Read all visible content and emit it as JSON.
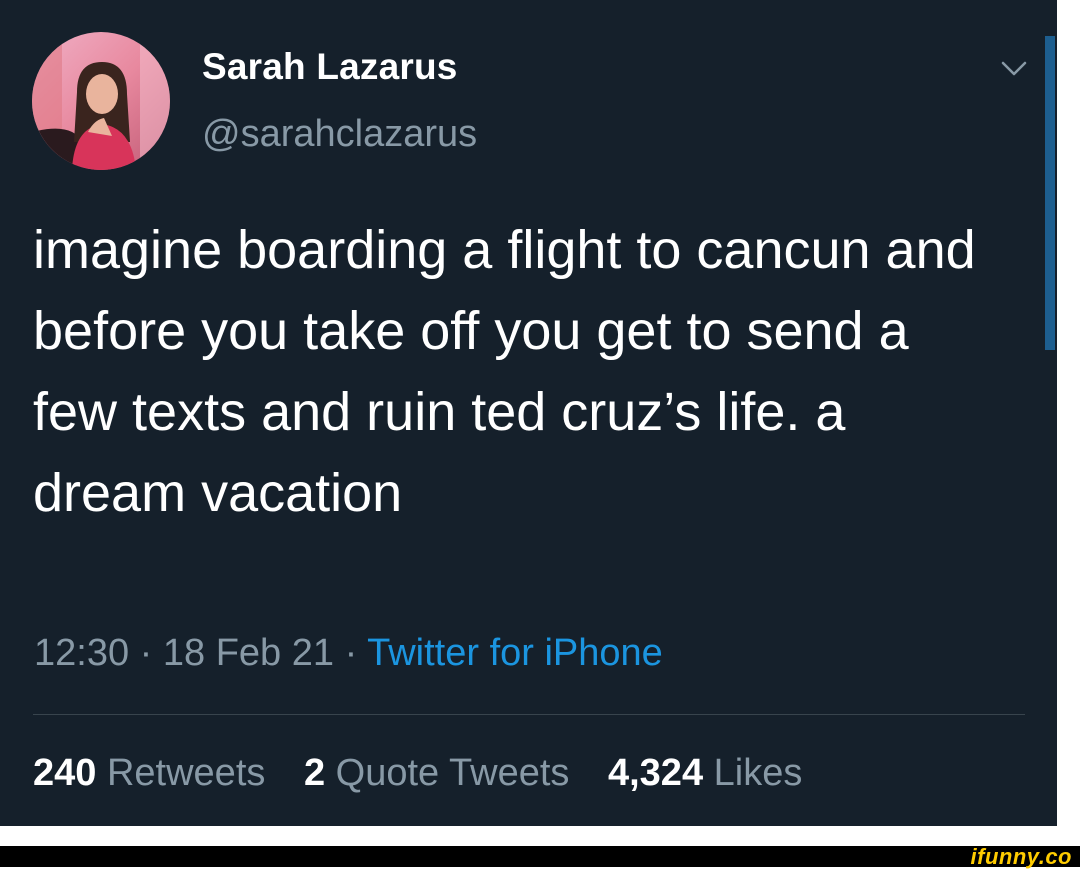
{
  "tweet": {
    "author": {
      "name": "Sarah Lazarus",
      "handle": "@sarahclazarus"
    },
    "text": "imagine boarding a flight to cancun and before you take off you get to send a few texts and ruin ted cruz’s life. a dream vacation",
    "time": "12:30",
    "date": "18 Feb 21",
    "separator": " · ",
    "source": "Twitter for iPhone",
    "stats": {
      "retweets_count": "240",
      "retweets_label": "Retweets",
      "quote_tweets_count": "2",
      "quote_tweets_label": "Quote Tweets",
      "likes_count": "4,324",
      "likes_label": "Likes"
    }
  },
  "footer": {
    "brand": "ifunny.co"
  },
  "colors": {
    "background": "#15202b",
    "text_primary": "#ffffff",
    "text_secondary": "#8899a6",
    "accent": "#1b95e0"
  },
  "icons": {
    "menu": "chevron-down-icon"
  }
}
